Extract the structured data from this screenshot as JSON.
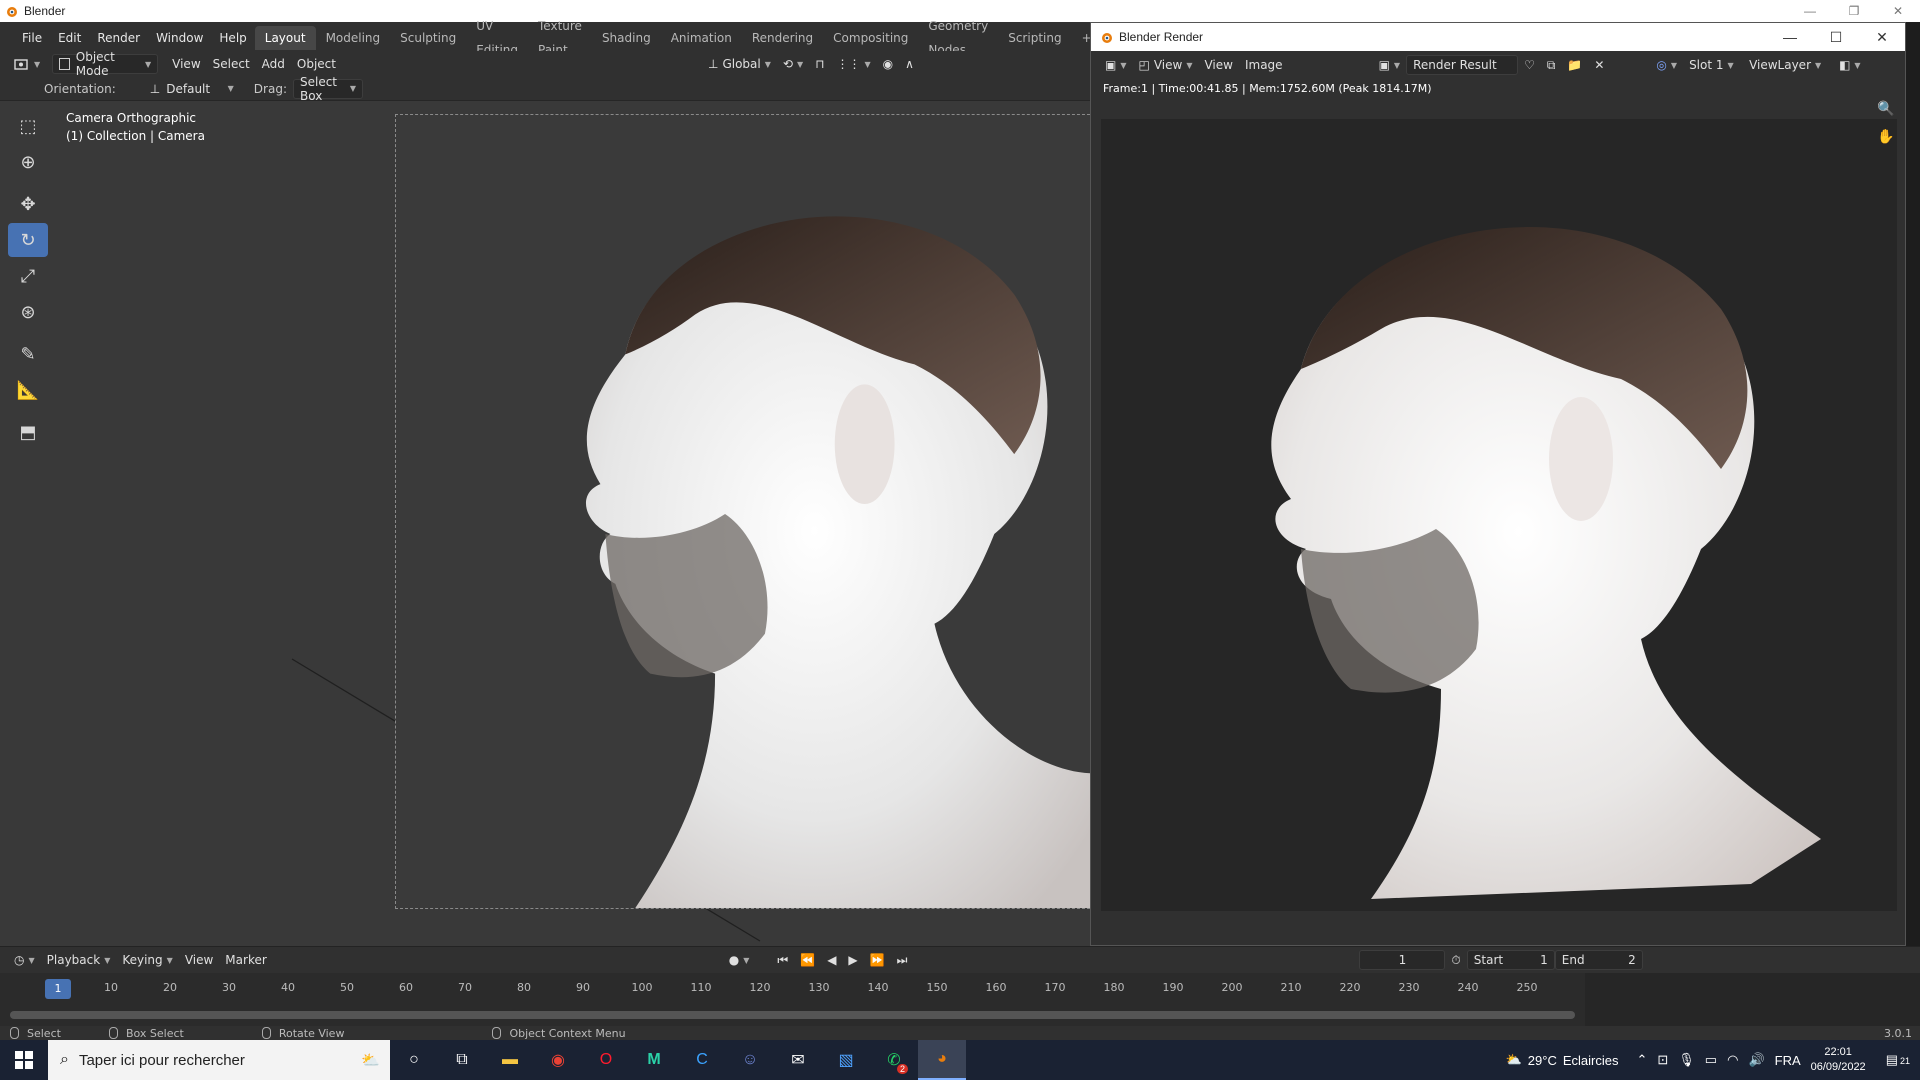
{
  "os_window": {
    "title": "Blender"
  },
  "menu": {
    "items": [
      "File",
      "Edit",
      "Render",
      "Window",
      "Help"
    ],
    "workspaces": [
      "Layout",
      "Modeling",
      "Sculpting",
      "UV Editing",
      "Texture Paint",
      "Shading",
      "Animation",
      "Rendering",
      "Compositing",
      "Geometry Nodes",
      "Scripting"
    ],
    "active_workspace": "Layout",
    "add_tab": "+"
  },
  "header": {
    "mode": "Object Mode",
    "menus": [
      "View",
      "Select",
      "Add",
      "Object"
    ],
    "transform_orientation": "Global"
  },
  "tool_settings": {
    "orientation_label": "Orientation:",
    "orientation_value": "Default",
    "drag_label": "Drag:",
    "drag_value": "Select Box"
  },
  "viewport": {
    "camera_line1": "Camera Orthographic",
    "camera_line2": "(1) Collection | Camera"
  },
  "render_window": {
    "title": "Blender Render",
    "view_menu": "View",
    "menus": [
      "View",
      "Image"
    ],
    "image_name": "Render Result",
    "slot": "Slot 1",
    "view_layer": "ViewLayer",
    "status": "Frame:1 | Time:00:41.85 | Mem:1752.60M (Peak 1814.17M)"
  },
  "timeline": {
    "menus": [
      "Playback",
      "Keying",
      "View",
      "Marker"
    ],
    "current_frame": "1",
    "current_frame_field": "1",
    "start_label": "Start",
    "start_value": "1",
    "end_label": "End",
    "end_value": "2",
    "ticks": [
      "10",
      "20",
      "30",
      "40",
      "50",
      "60",
      "70",
      "80",
      "90",
      "100",
      "110",
      "120",
      "130",
      "140",
      "150",
      "160",
      "170",
      "180",
      "190",
      "200",
      "210",
      "220",
      "230",
      "240",
      "250"
    ]
  },
  "statusbar": {
    "items": [
      "Select",
      "Box Select",
      "Rotate View",
      "Object Context Menu"
    ],
    "version": "3.0.1"
  },
  "taskbar": {
    "search_placeholder": "Taper ici pour rechercher",
    "weather_temp": "29°C",
    "weather_desc": "Eclaircies",
    "language": "FRA",
    "time": "22:01",
    "date": "06/09/2022",
    "notifications": "21",
    "whatsapp_badge": "2"
  },
  "colors": {
    "accent_blue": "#4772b3",
    "panel": "#303030",
    "viewport": "#393939",
    "render_bg": "#262626"
  }
}
